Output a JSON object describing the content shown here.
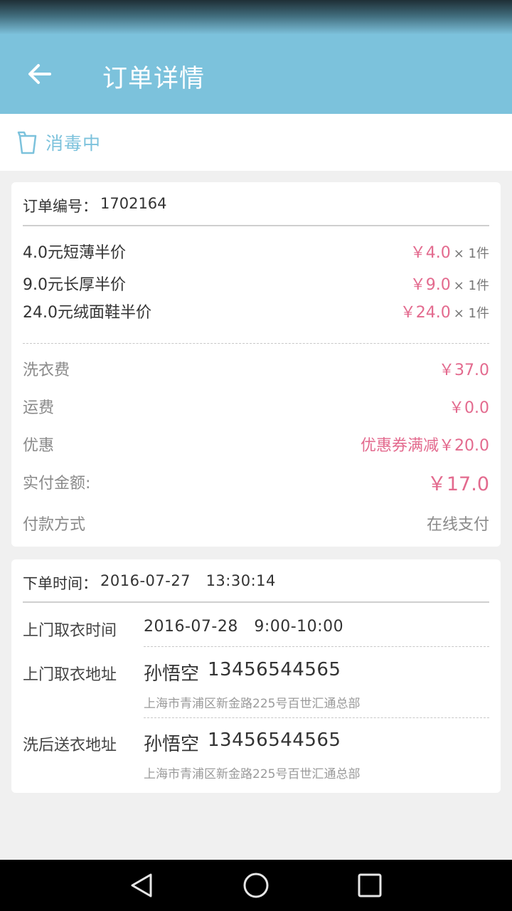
{
  "header": {
    "title": "订单详情"
  },
  "status": {
    "text": "消毒中"
  },
  "order": {
    "number_label": "订单编号：",
    "number": "1702164",
    "items": [
      {
        "name": "4.0元短薄半价",
        "price": "￥4.0",
        "qty": "× 1件"
      },
      {
        "name": "9.0元长厚半价",
        "price": "￥9.0",
        "qty": "× 1件"
      },
      {
        "name": "24.0元绒面鞋半价",
        "price": "￥24.0",
        "qty": "× 1件"
      }
    ],
    "fees": {
      "wash_label": "洗衣费",
      "wash_value": "￥37.0",
      "shipping_label": "运费",
      "shipping_value": "￥0.0",
      "discount_label": "优惠",
      "discount_value": "优惠券满减￥20.0",
      "paid_label": "实付金额:",
      "paid_value": "￥17.0",
      "method_label": "付款方式",
      "method_value": "在线支付"
    }
  },
  "schedule": {
    "order_time_label": "下单时间：",
    "order_time": "2016-07-27   13:30:14",
    "pickup_time_label": "上门取衣时间",
    "pickup_time": "2016-07-28   9:00-10:00",
    "pickup_addr_label": "上门取衣地址",
    "pickup_name": "孙悟空",
    "pickup_phone": "13456544565",
    "pickup_address": "上海市青浦区新金路225号百世汇通总部",
    "delivery_addr_label": "洗后送衣地址",
    "delivery_name": "孙悟空",
    "delivery_phone": "13456544565",
    "delivery_address": "上海市青浦区新金路225号百世汇通总部"
  },
  "colors": {
    "accent": "#7cc2dc",
    "price": "#e36a8e",
    "muted": "#8a8a8a"
  },
  "icons": {
    "back": "arrow-left-icon",
    "status": "cup-icon",
    "nav_back": "triangle-back-icon",
    "nav_home": "circle-home-icon",
    "nav_recent": "square-recent-icon"
  }
}
